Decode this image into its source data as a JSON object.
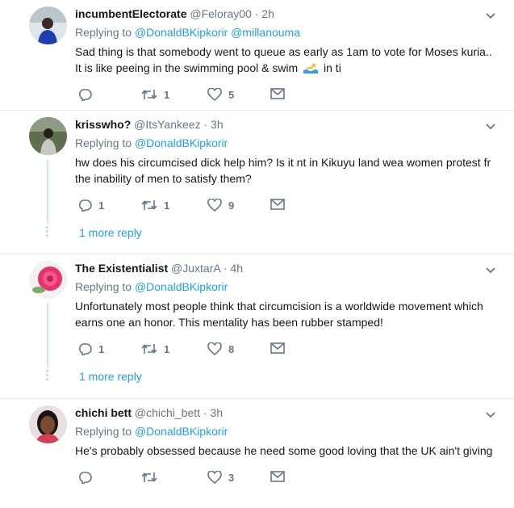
{
  "tweets": [
    {
      "name": "incumbentElectorate",
      "handle": "@Feloray00",
      "time": "2h",
      "replying_label": "Replying to",
      "replying_to": [
        "@DonaldBKipkorir",
        "@millanouma"
      ],
      "text_before_emoji": "Sad thing is that somebody went to queue as early as 1am to vote for Moses kuria.. It is like peeing in the swimming pool & swim",
      "emoji": "swimmer-emoji",
      "text_after_emoji": "in ti",
      "reply_count": "",
      "retweet_count": "1",
      "like_count": "5",
      "more_reply": ""
    },
    {
      "name": "krisswho?",
      "handle": "@ItsYankeez",
      "time": "3h",
      "replying_label": "Replying to",
      "replying_to": [
        "@DonaldBKipkorir"
      ],
      "text": "hw does his circumcised dick help him? Is it nt in Kikuyu land wea women protest fr the inability of men to satisfy them?",
      "reply_count": "1",
      "retweet_count": "1",
      "like_count": "9",
      "more_reply": "1 more reply"
    },
    {
      "name": "The Existentialist",
      "handle": "@JuxtarA",
      "time": "4h",
      "replying_label": "Replying to",
      "replying_to": [
        "@DonaldBKipkorir"
      ],
      "text": "Unfortunately most people think that circumcision is a worldwide movement which earns one an honor. This mentality has been rubber stamped!",
      "reply_count": "1",
      "retweet_count": "1",
      "like_count": "8",
      "more_reply": "1 more reply"
    },
    {
      "name": "chichi bett",
      "handle": "@chichi_bett",
      "time": "3h",
      "replying_label": "Replying to",
      "replying_to": [
        "@DonaldBKipkorir"
      ],
      "text": "He's probably obsessed because he need some good loving that the UK ain't giving",
      "reply_count": "",
      "retweet_count": "",
      "like_count": "3",
      "more_reply": ""
    }
  ],
  "colors": {
    "link": "#1da1f2",
    "muted": "#657786",
    "border": "#e6ecf0",
    "thread_line": "#c9e6f9"
  },
  "separator": "·"
}
